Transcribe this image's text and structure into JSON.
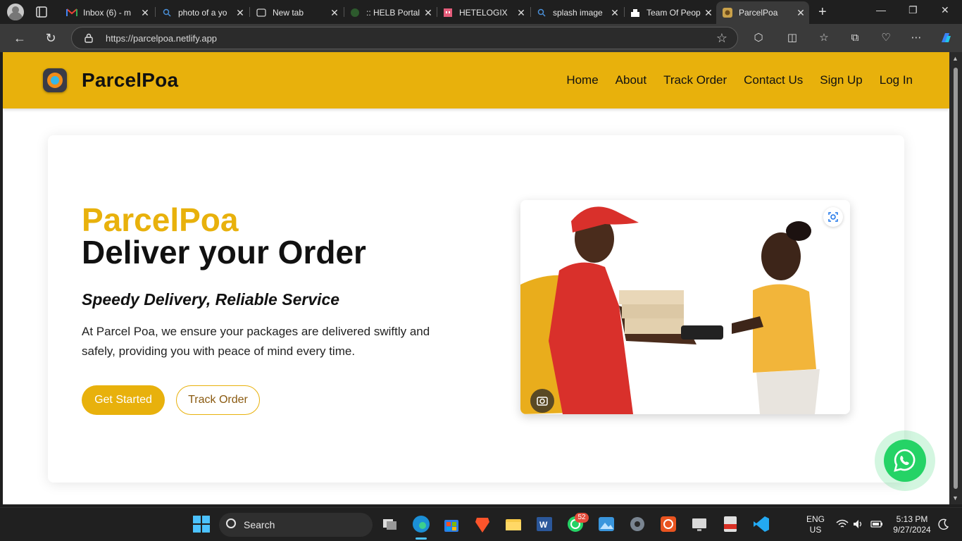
{
  "browser": {
    "tabs": [
      {
        "title": "Inbox (6) - m",
        "icon": "gmail-icon",
        "active": false
      },
      {
        "title": "photo of a yo",
        "icon": "search-icon",
        "active": false
      },
      {
        "title": "New tab",
        "icon": "newtab-icon",
        "active": false
      },
      {
        "title": ":: HELB Portal",
        "icon": "helb-icon",
        "active": false
      },
      {
        "title": "HETELOGIX",
        "icon": "hotel-icon",
        "active": false
      },
      {
        "title": "splash image",
        "icon": "search-icon",
        "active": false
      },
      {
        "title": "Team Of Peop",
        "icon": "team-icon",
        "active": false
      },
      {
        "title": "ParcelPoa",
        "icon": "parcelpoa-icon",
        "active": true
      }
    ],
    "url": "https://parcelpoa.netlify.app"
  },
  "site": {
    "brand": "ParcelPoa",
    "nav": [
      "Home",
      "About",
      "Track Order",
      "Contact Us",
      "Sign Up",
      "Log In"
    ],
    "accent_color": "#e8b10c"
  },
  "hero": {
    "brand": "ParcelPoa",
    "title": "Deliver your Order",
    "subtitle": "Speedy Delivery, Reliable Service",
    "description": "At Parcel Poa, we ensure your packages are delivered swiftly and safely, providing you with peace of mind every time.",
    "primary_button": "Get Started",
    "secondary_button": "Track Order"
  },
  "taskbar": {
    "search_label": "Search",
    "whatsapp_badge": "52",
    "language": "ENG",
    "region": "US",
    "time": "5:13 PM",
    "date": "9/27/2024"
  }
}
